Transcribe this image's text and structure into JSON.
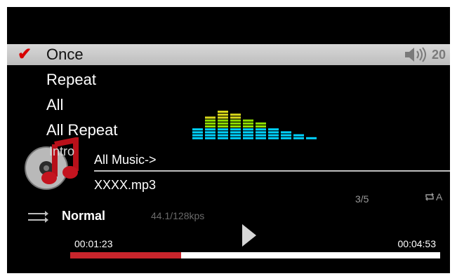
{
  "menu": {
    "items": [
      {
        "label": "Once",
        "selected": true
      },
      {
        "label": "Repeat",
        "selected": false
      },
      {
        "label": "All",
        "selected": false
      },
      {
        "label": "All Repeat",
        "selected": false
      }
    ],
    "check_icon": "checkmark-icon"
  },
  "volume": {
    "value": "20",
    "icon": "speaker-icon"
  },
  "equalizer": {
    "bar_levels": [
      0,
      0,
      4,
      8,
      10,
      9,
      7,
      6,
      4,
      3,
      2,
      1
    ],
    "max_level": 12,
    "colors": {
      "top": "#d9d91b",
      "mid": "#90e000",
      "low": "#00d2ff"
    }
  },
  "track": {
    "folder": "All Music->",
    "filename": "XXXX.mp3",
    "album_icon": "music-note-disc-icon",
    "partial_menu_text": "Intro"
  },
  "status": {
    "count": "3/5",
    "repeat_label": "A",
    "eq_mode": "Normal",
    "bitrate": "44.1/128kps",
    "shuffle_icon": "shuffle-icon",
    "play_icon": "play-icon"
  },
  "progress": {
    "elapsed": "00:01:23",
    "total": "00:04:53",
    "fraction": 0.3,
    "fill_color": "#c9252c"
  }
}
